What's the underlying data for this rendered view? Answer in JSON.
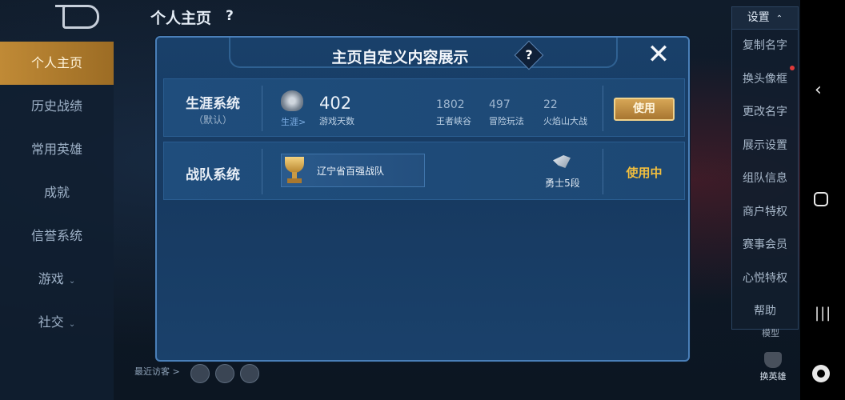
{
  "page": {
    "title": "个人主页",
    "help": "?"
  },
  "left_nav": {
    "items": [
      {
        "label": "个人主页",
        "active": true
      },
      {
        "label": "历史战绩"
      },
      {
        "label": "常用英雄"
      },
      {
        "label": "成就"
      },
      {
        "label": "信誉系统"
      },
      {
        "label": "游戏",
        "chevron": "chevron-down-icon"
      },
      {
        "label": "社交",
        "chevron": "chevron-down-icon"
      }
    ],
    "visitors_label": "最近访客 >"
  },
  "settings": {
    "header": "设置",
    "items": [
      "复制名字",
      "换头像框",
      "更改名字",
      "展示设置",
      "组队信息",
      "商户特权",
      "赛事会员",
      "心悦特权",
      "帮助"
    ]
  },
  "bottom_right": {
    "hero_label": "换英雄",
    "mask_label": "模型"
  },
  "dialog": {
    "title": "主页自定义内容展示",
    "help": "?",
    "close": "✕",
    "rows": [
      {
        "name": "生涯系统",
        "sub": "（默认）",
        "emblem_label": "生涯>",
        "big_value": "402",
        "big_label": "游戏天数",
        "stats": [
          {
            "value": "1802",
            "label": "王者峡谷"
          },
          {
            "value": "497",
            "label": "冒险玩法"
          },
          {
            "value": "22",
            "label": "火焰山大战"
          }
        ],
        "action": "使用"
      },
      {
        "name": "战队系统",
        "team_name": "辽宁省百强战队",
        "rank_label": "勇士5段",
        "action": "使用中"
      }
    ]
  },
  "colors": {
    "accent_gold": "#f1be3e",
    "dialog_bg": "#173a61",
    "active_nav": "#c08a36"
  }
}
